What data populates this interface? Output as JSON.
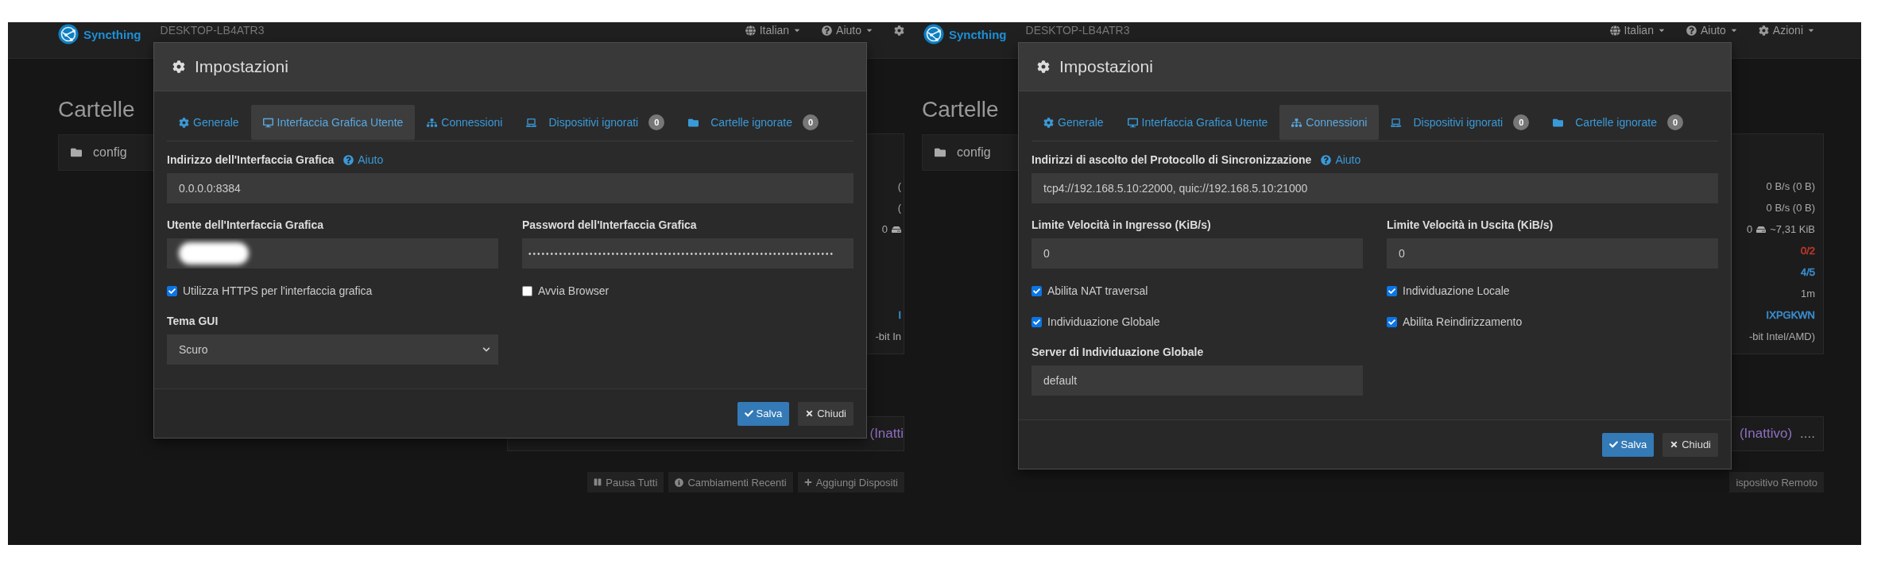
{
  "screens": [
    {
      "navbar": {
        "brand": "Syncthing",
        "device": "DESKTOP-LB4ATR3",
        "menus": [
          {
            "kind": "language",
            "label": "Italian"
          },
          {
            "kind": "help",
            "label": "Aiuto"
          },
          {
            "kind": "actions"
          }
        ]
      },
      "heading": "Cartelle",
      "folders": [
        {
          "name": "config"
        }
      ],
      "device_rows": [
        {
          "text": "("
        },
        {
          "text": "("
        },
        {
          "kind": "storage",
          "text": "0"
        },
        {
          "kind": "blank"
        },
        {
          "kind": "blank"
        },
        {
          "kind": "blank"
        },
        {
          "text": "I",
          "color": "#3a8fd0"
        },
        {
          "text": "-bit In"
        }
      ],
      "device_status": {
        "state": "(Inatti"
      },
      "buttons": [
        {
          "kind": "pause",
          "label": "Pausa Tutti"
        },
        {
          "kind": "info",
          "label": "Cambiamenti Recenti"
        },
        {
          "kind": "add",
          "label": "Aggiungi Dispositi"
        }
      ],
      "modal": {
        "title": "Impostazioni",
        "tabs": [
          {
            "label": "Generale",
            "selected": false
          },
          {
            "label": "Interfaccia Grafica Utente",
            "selected": true
          },
          {
            "label": "Connessioni",
            "selected": false
          },
          {
            "label": "Dispositivi ignorati",
            "badge": "0",
            "selected": false
          },
          {
            "label": "Cartelle ignorate",
            "badge": "0",
            "selected": false
          }
        ],
        "address": {
          "label": "Indirizzo dell'Interfaccia Grafica",
          "help": "Aiuto",
          "value": "0.0.0.0:8384"
        },
        "fields": [
          {
            "kind": "input",
            "label": "Utente dell'Interfaccia Grafica",
            "redacted": true
          },
          {
            "kind": "password",
            "label": "Password dell'Interfaccia Grafica",
            "value": "••••••••••••••••••••••••••••••••••••••••••••••••••••••••••••••••••••••"
          },
          {
            "kind": "checkbox",
            "label": "Utilizza HTTPS per l'interfaccia grafica",
            "checked": true
          },
          {
            "kind": "checkbox",
            "label": "Avvia Browser",
            "checked": false
          },
          {
            "kind": "select",
            "label": "Tema GUI",
            "value": "Scuro"
          }
        ],
        "buttons": [
          {
            "kind": "primary",
            "label": "Salva"
          },
          {
            "kind": "default",
            "label": "Chiudi"
          }
        ]
      }
    },
    {
      "navbar": {
        "brand": "Syncthing",
        "device": "DESKTOP-LB4ATR3",
        "menus": [
          {
            "kind": "language",
            "label": "Italian"
          },
          {
            "kind": "help",
            "label": "Aiuto"
          },
          {
            "kind": "actions",
            "label": "Azioni"
          }
        ]
      },
      "heading": "Cartelle",
      "folders": [
        {
          "name": "config"
        }
      ],
      "device_rows": [
        {
          "text": "0 B/s (0 B)"
        },
        {
          "text": "0 B/s (0 B)"
        },
        {
          "kind": "storage",
          "text": "0",
          "extra": "~7,31 KiB"
        },
        {
          "text": "0/2",
          "color": "#c0392b"
        },
        {
          "text": "4/5",
          "color": "#3a8fd0"
        },
        {
          "text": "1m"
        },
        {
          "text": "IXPGKWN",
          "color": "#3a8fd0"
        },
        {
          "text": "-bit Intel/AMD)"
        }
      ],
      "device_status": {
        "state": "(Inattivo)",
        "more": "...."
      },
      "buttons": [
        {
          "kind": "text",
          "label": "ispositivo Remoto"
        }
      ],
      "modal": {
        "title": "Impostazioni",
        "tabs": [
          {
            "label": "Generale",
            "selected": false
          },
          {
            "label": "Interfaccia Grafica Utente",
            "selected": false
          },
          {
            "label": "Connessioni",
            "selected": true
          },
          {
            "label": "Dispositivi ignorati",
            "badge": "0",
            "selected": false
          },
          {
            "label": "Cartelle ignorate",
            "badge": "0",
            "selected": false
          }
        ],
        "address": {
          "label": "Indirizzi di ascolto del Protocollo di Sincronizzazione",
          "help": "Aiuto",
          "value": "tcp4://192.168.5.10:22000, quic://192.168.5.10:21000"
        },
        "fields": [
          {
            "kind": "input",
            "label": "Limite Velocità in Ingresso (KiB/s)",
            "value": "0"
          },
          {
            "kind": "input",
            "label": "Limite Velocità in Uscita (KiB/s)",
            "value": "0"
          },
          {
            "kind": "checkbox",
            "label": "Abilita NAT traversal",
            "checked": true
          },
          {
            "kind": "checkbox",
            "label": "Individuazione Locale",
            "checked": true
          },
          {
            "kind": "checkbox",
            "label": "Individuazione Globale",
            "checked": true
          },
          {
            "kind": "checkbox",
            "label": "Abilita Reindirizzamento",
            "checked": true
          },
          {
            "kind": "input",
            "label": "Server di Individuazione Globale",
            "value": "default"
          }
        ],
        "buttons": [
          {
            "kind": "primary",
            "label": "Salva"
          },
          {
            "kind": "default",
            "label": "Chiudi"
          }
        ]
      }
    }
  ]
}
